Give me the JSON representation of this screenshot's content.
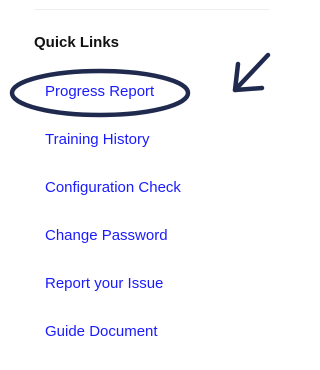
{
  "quick_links": {
    "title": "Quick Links",
    "items": [
      {
        "label": "Progress Report"
      },
      {
        "label": "Training History"
      },
      {
        "label": "Configuration Check"
      },
      {
        "label": "Change Password"
      },
      {
        "label": "Report your Issue"
      },
      {
        "label": "Guide Document"
      }
    ]
  },
  "colors": {
    "link": "#1a1aff",
    "annotation": "#1f2a4e",
    "title": "#111111"
  },
  "annotation": {
    "icons": [
      "highlight-ellipse",
      "pointer-arrow"
    ],
    "highlighted_item": "Progress Report"
  }
}
